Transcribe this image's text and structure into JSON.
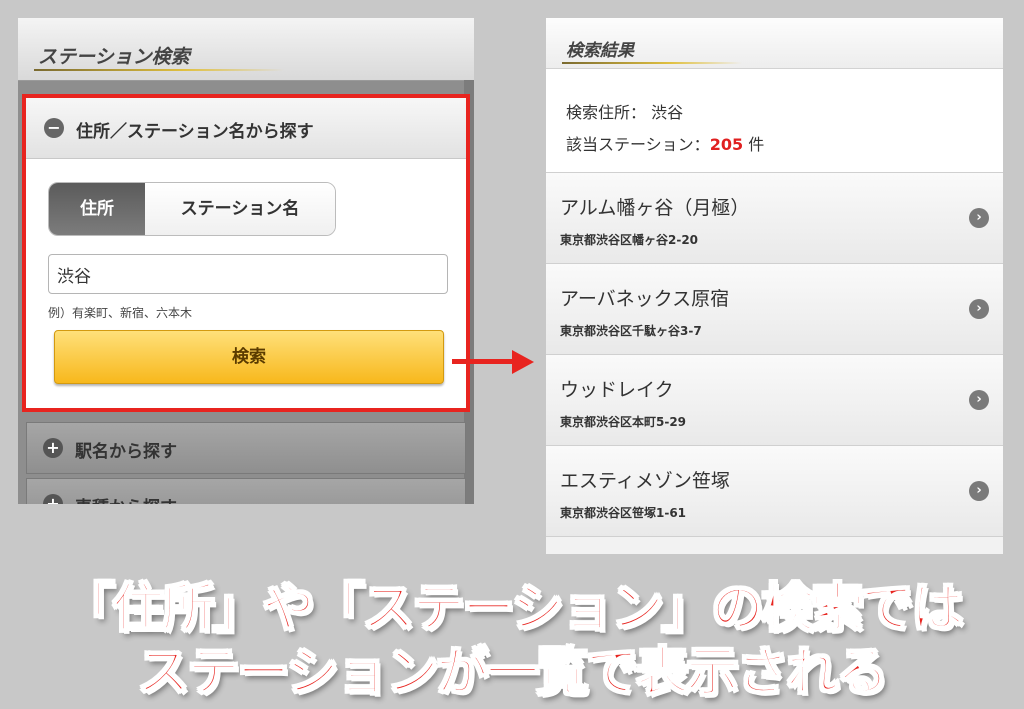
{
  "left": {
    "header_title": "ステーション検索",
    "accordion_open_label": "住所／ステーション名から探す",
    "toggle": {
      "address_label": "住所",
      "station_label": "ステーション名"
    },
    "input_value": "渋谷",
    "input_hint": "例）有楽町、新宿、六本木",
    "search_button_label": "検索",
    "accordion_items": [
      {
        "label": "駅名から探す"
      },
      {
        "label": "車種から探す"
      }
    ]
  },
  "right": {
    "header_title": "検索結果",
    "address_label": "検索住所：",
    "address_value": "渋谷",
    "count_label": "該当ステーション：",
    "count_value": "205",
    "count_unit": "件",
    "results": [
      {
        "name": "アルム幡ヶ谷（月極）",
        "address": "東京都渋谷区幡ヶ谷2-20"
      },
      {
        "name": "アーバネックス原宿",
        "address": "東京都渋谷区千駄ヶ谷3-7"
      },
      {
        "name": "ウッドレイク",
        "address": "東京都渋谷区本町5-29"
      },
      {
        "name": "エスティメゾン笹塚",
        "address": "東京都渋谷区笹塚1-61"
      }
    ]
  },
  "caption": {
    "line1": "「住所」や「ステーション」の検索では",
    "line2": "ステーションが一覧で表示される"
  },
  "colors": {
    "accent_red": "#e8241f",
    "button_yellow": "#f7b81c",
    "count_red": "#e02020"
  },
  "icons": {
    "open": "minus-circle-icon",
    "closed": "plus-circle-icon",
    "row": "chevron-right-icon",
    "arrow": "arrow-right-icon"
  }
}
